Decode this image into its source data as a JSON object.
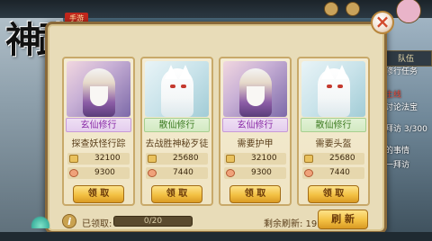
{
  "logo": {
    "title": "神武",
    "seal": "手游"
  },
  "right_panel": {
    "team_tab": "队伍",
    "lines": [
      "修行任务",
      "主线",
      "讨论法宝",
      "拜访 3/300",
      "的事情",
      "一拜访"
    ]
  },
  "cards": [
    {
      "type": "玄仙修行",
      "type_color": "purple",
      "portrait": "mage",
      "task": "探查妖怪行踪",
      "exp": "32100",
      "coin": "9300",
      "claim": "领 取"
    },
    {
      "type": "散仙修行",
      "type_color": "green",
      "portrait": "fox",
      "task": "去战胜神秘歹徒",
      "exp": "25680",
      "coin": "7440",
      "claim": "领 取"
    },
    {
      "type": "玄仙修行",
      "type_color": "purple",
      "portrait": "mage",
      "task": "需要护甲",
      "exp": "32100",
      "coin": "9300",
      "claim": "领 取"
    },
    {
      "type": "散仙修行",
      "type_color": "green",
      "portrait": "fox",
      "task": "需要头盔",
      "exp": "25680",
      "coin": "7440",
      "claim": "领 取"
    }
  ],
  "footer": {
    "info_icon": "i",
    "claimed_label": "已领取:",
    "progress_text": "0/20",
    "progress_fraction": 0,
    "refresh_count": "剩余刷新: 19",
    "refresh_button": "刷 新"
  },
  "close_button": "×",
  "colors": {
    "panel_bg": "#e8dcb8",
    "button_gold": "#f3c143",
    "purple_tag": "#8b2da8",
    "green_tag": "#3f7d24"
  }
}
